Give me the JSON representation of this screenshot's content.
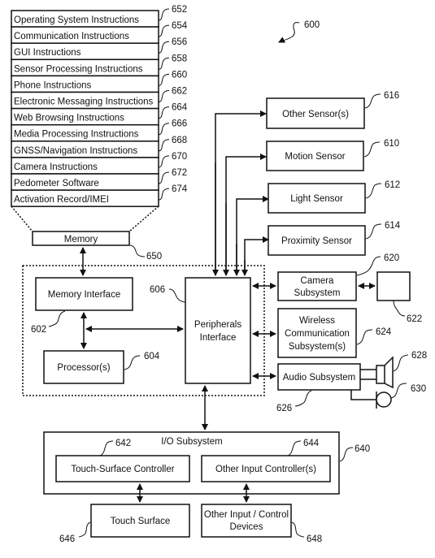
{
  "figure_ref": "600",
  "memory_stack": {
    "items": [
      {
        "label": "Operating System Instructions",
        "ref": "652"
      },
      {
        "label": "Communication Instructions",
        "ref": "654"
      },
      {
        "label": "GUI Instructions",
        "ref": "656"
      },
      {
        "label": "Sensor Processing Instructions",
        "ref": "658"
      },
      {
        "label": "Phone Instructions",
        "ref": "660"
      },
      {
        "label": "Electronic Messaging Instructions",
        "ref": "662"
      },
      {
        "label": "Web Browsing Instructions",
        "ref": "664"
      },
      {
        "label": "Media Processing Instructions",
        "ref": "666"
      },
      {
        "label": "GNSS/Navigation Instructions",
        "ref": "668"
      },
      {
        "label": "Camera Instructions",
        "ref": "670"
      },
      {
        "label": "Pedometer Software",
        "ref": "672"
      },
      {
        "label": "Activation Record/IMEI",
        "ref": "674"
      }
    ]
  },
  "memory": {
    "label": "Memory",
    "ref": "650"
  },
  "memory_interface": {
    "label": "Memory Interface",
    "ref": "602"
  },
  "processor": {
    "label": "Processor(s)",
    "ref": "604"
  },
  "peripherals_interface": {
    "line1": "Peripherals",
    "line2": "Interface",
    "ref": "606"
  },
  "sensors": {
    "other": {
      "label": "Other Sensor(s)",
      "ref": "616"
    },
    "motion": {
      "label": "Motion Sensor",
      "ref": "610"
    },
    "light": {
      "label": "Light Sensor",
      "ref": "612"
    },
    "proximity": {
      "label": "Proximity Sensor",
      "ref": "614"
    }
  },
  "camera_subsystem": {
    "line1": "Camera",
    "line2": "Subsystem",
    "ref": "620",
    "device_ref": "622"
  },
  "wireless": {
    "line1": "Wireless",
    "line2": "Communication",
    "line3": "Subsystem(s)",
    "ref": "624"
  },
  "audio": {
    "label": "Audio Subsystem",
    "ref": "626",
    "speaker_ref": "628",
    "mic_ref": "630"
  },
  "io_subsystem": {
    "label": "I/O Subsystem",
    "ref": "640",
    "touch_controller": {
      "label": "Touch-Surface Controller",
      "ref": "642"
    },
    "other_controller": {
      "label": "Other Input Controller(s)",
      "ref": "644"
    },
    "touch_surface": {
      "label": "Touch Surface",
      "ref": "646"
    },
    "other_devices": {
      "line1": "Other Input / Control",
      "line2": "Devices",
      "ref": "648"
    }
  }
}
